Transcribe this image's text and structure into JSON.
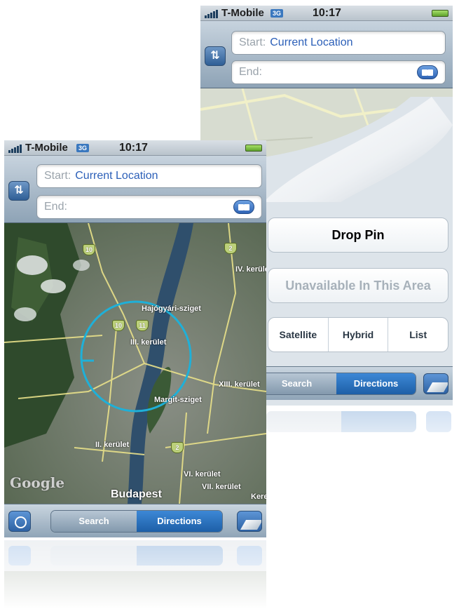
{
  "status_bar": {
    "carrier": "T-Mobile",
    "network": "3G",
    "time": "10:17"
  },
  "directions": {
    "start_label": "Start:",
    "start_value": "Current Location",
    "end_label": "End:"
  },
  "back_menu": {
    "drop_pin": "Drop Pin",
    "traffic_unavailable": "Unavailable In This Area",
    "map_types": [
      "Satellite",
      "Hybrid",
      "List"
    ]
  },
  "toolbar": {
    "search_label": "Search",
    "directions_label": "Directions"
  },
  "map": {
    "city": "Budapest",
    "attribution": "Google",
    "labels": [
      "Hajógyári-sziget",
      "III. kerület",
      "IV. kerület",
      "XIII. kerület",
      "Margit-sziget",
      "II. kerület",
      "VI. kerület",
      "VII. kerület",
      "Kerep"
    ],
    "road_shields": [
      "10",
      "2",
      "10",
      "11",
      "2"
    ]
  },
  "colors": {
    "accent_blue": "#1d5fa7",
    "link_blue": "#2b5fb8",
    "river": "#2f4f6c",
    "locator_circle": "#1fb0d8"
  }
}
